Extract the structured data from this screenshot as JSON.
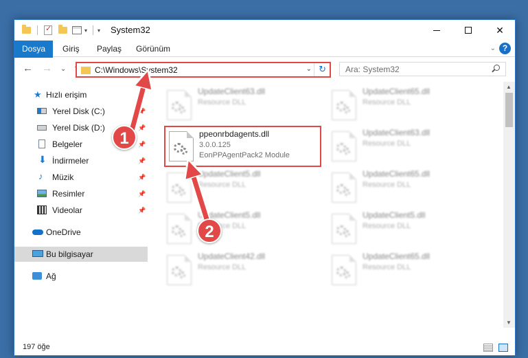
{
  "window": {
    "title": "System32"
  },
  "ribbon": {
    "tabs": [
      "Dosya",
      "Giriş",
      "Paylaş",
      "Görünüm"
    ]
  },
  "address": {
    "path": "C:\\Windows\\System32"
  },
  "search": {
    "placeholder": "Ara: System32"
  },
  "sidebar": {
    "items": [
      {
        "label": "Hızlı erişim",
        "icon": "star-icon"
      },
      {
        "label": "Yerel Disk (C:)",
        "icon": "drive-icon",
        "pinned": true
      },
      {
        "label": "Yerel Disk (D:)",
        "icon": "drive-icon",
        "pinned": true
      },
      {
        "label": "Belgeler",
        "icon": "documents-icon",
        "pinned": true
      },
      {
        "label": "İndirmeler",
        "icon": "download-icon",
        "pinned": true
      },
      {
        "label": "Müzik",
        "icon": "music-icon",
        "pinned": true
      },
      {
        "label": "Resimler",
        "icon": "pictures-icon",
        "pinned": true
      },
      {
        "label": "Videolar",
        "icon": "videos-icon",
        "pinned": true
      },
      {
        "label": "OneDrive",
        "icon": "cloud-icon"
      },
      {
        "label": "Bu bilgisayar",
        "icon": "computer-icon",
        "selected": true
      },
      {
        "label": "Ağ",
        "icon": "network-icon"
      }
    ]
  },
  "files": [
    {
      "name": "UpdateClient63.dll",
      "type": "Resource DLL"
    },
    {
      "name": "UpdateClient65.dll",
      "type": "Resource DLL"
    },
    {
      "name": "ppeonrbdagents.dll",
      "version": "3.0.0.125",
      "description": "EonPPAgentPack2 Module",
      "highlighted": true
    },
    {
      "name": "UpdateClient63.dll",
      "type": "Resource DLL"
    },
    {
      "name": "UpdateClient5.dll",
      "type": "Resource DLL"
    },
    {
      "name": "UpdateClient65.dll",
      "type": "Resource DLL"
    },
    {
      "name": "UpdateClient5.dll",
      "type": "Resource DLL"
    },
    {
      "name": "UpdateClient5.dll",
      "type": "Resource DLL"
    },
    {
      "name": "UpdateClient42.dll",
      "type": "Resource DLL"
    },
    {
      "name": "UpdateClient65.dll",
      "type": "Resource DLL"
    }
  ],
  "status": {
    "count": "197 öğe"
  },
  "callouts": [
    "1",
    "2"
  ],
  "colors": {
    "accent": "#1979ca",
    "highlight": "#e04848"
  }
}
